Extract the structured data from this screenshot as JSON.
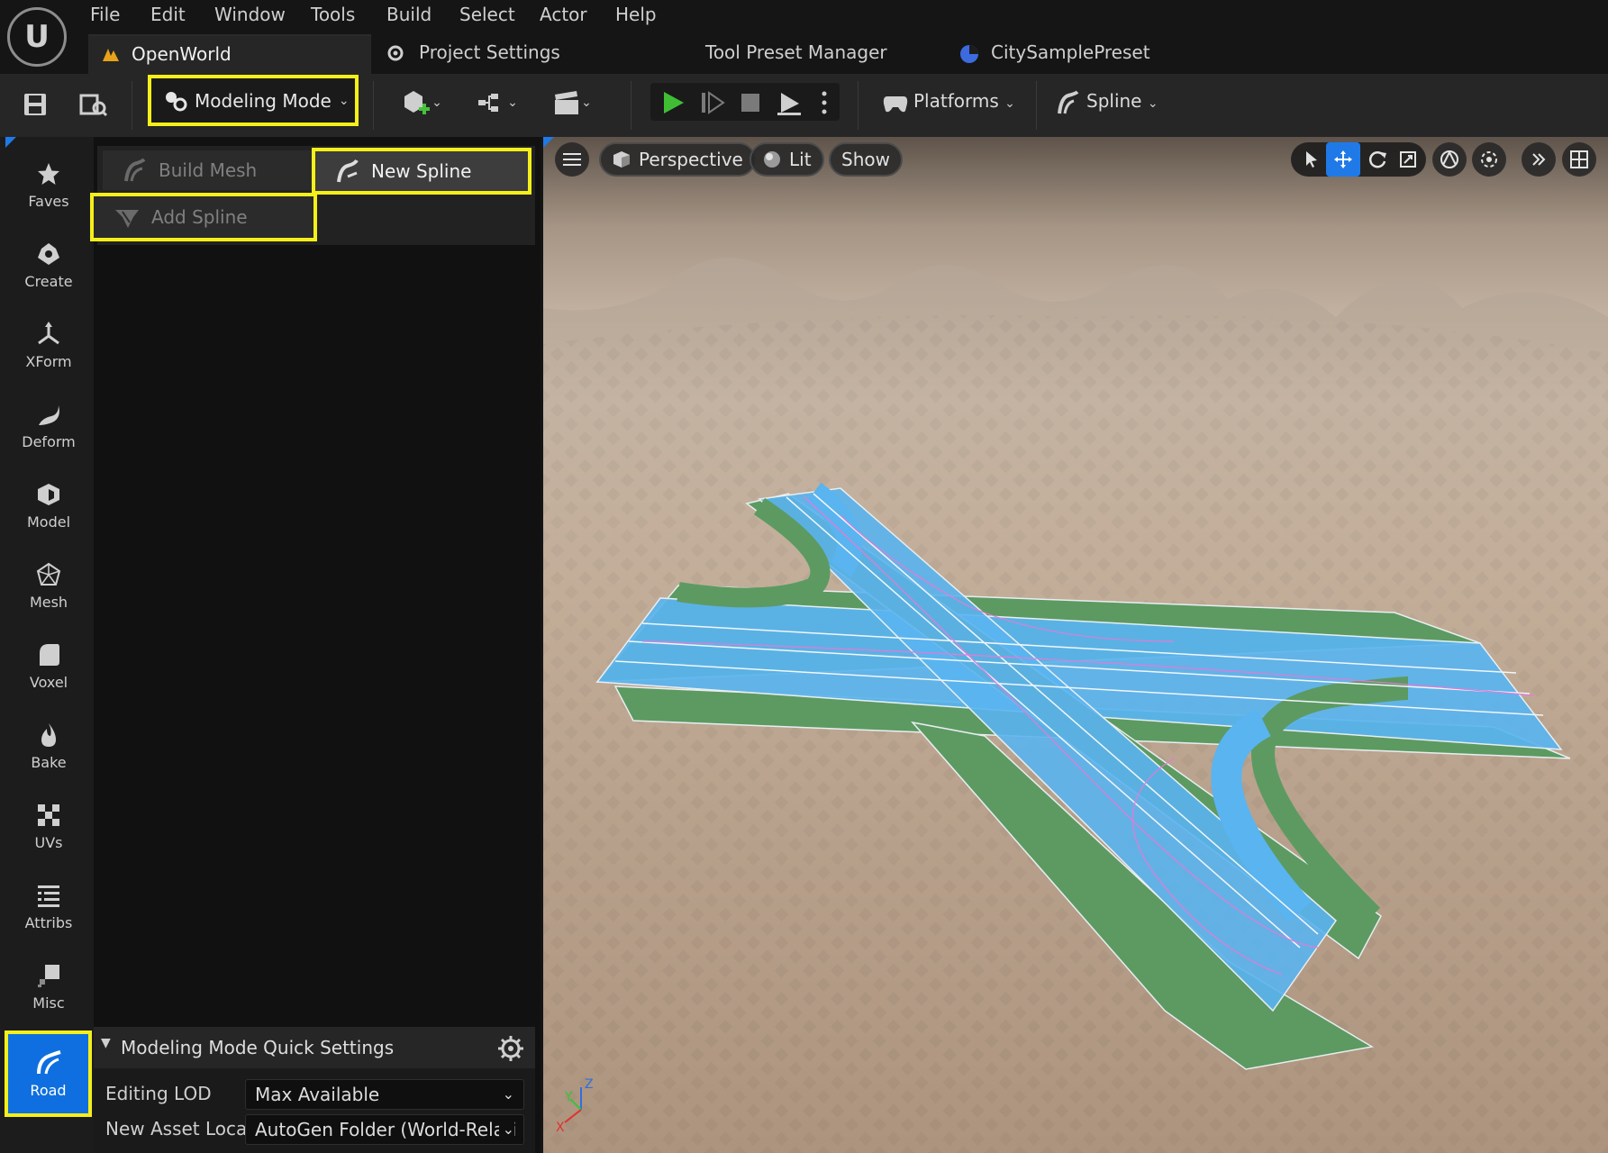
{
  "menu": [
    "File",
    "Edit",
    "Window",
    "Tools",
    "Build",
    "Select",
    "Actor",
    "Help"
  ],
  "tabs": {
    "openworld": "OpenWorld",
    "project_settings": "Project Settings",
    "tool_preset_manager": "Tool Preset Manager",
    "city_sample_preset": "CitySamplePreset"
  },
  "toolbar": {
    "modeling_mode": "Modeling Mode",
    "platforms": "Platforms",
    "spline": "Spline"
  },
  "rail": [
    "Faves",
    "Create",
    "XForm",
    "Deform",
    "Model",
    "Mesh",
    "Voxel",
    "Bake",
    "UVs",
    "Attribs",
    "Misc",
    "Road"
  ],
  "tools": {
    "build_mesh": "Build Mesh",
    "new_spline": "New Spline",
    "add_spline": "Add Spline"
  },
  "quick_settings": {
    "title": "Modeling Mode Quick Settings",
    "editing_lod_label": "Editing LOD",
    "editing_lod_value": "Max Available",
    "new_asset_label": "New Asset Locati",
    "new_asset_value": "AutoGen Folder (World-Relati"
  },
  "viewport": {
    "perspective": "Perspective",
    "lit": "Lit",
    "show": "Show"
  },
  "colors": {
    "highlight": "#f5ef1a",
    "road_mode": "#0f6fe0",
    "lane_blue": "#5ab4ef",
    "shoulder_green": "#5c9a62"
  }
}
